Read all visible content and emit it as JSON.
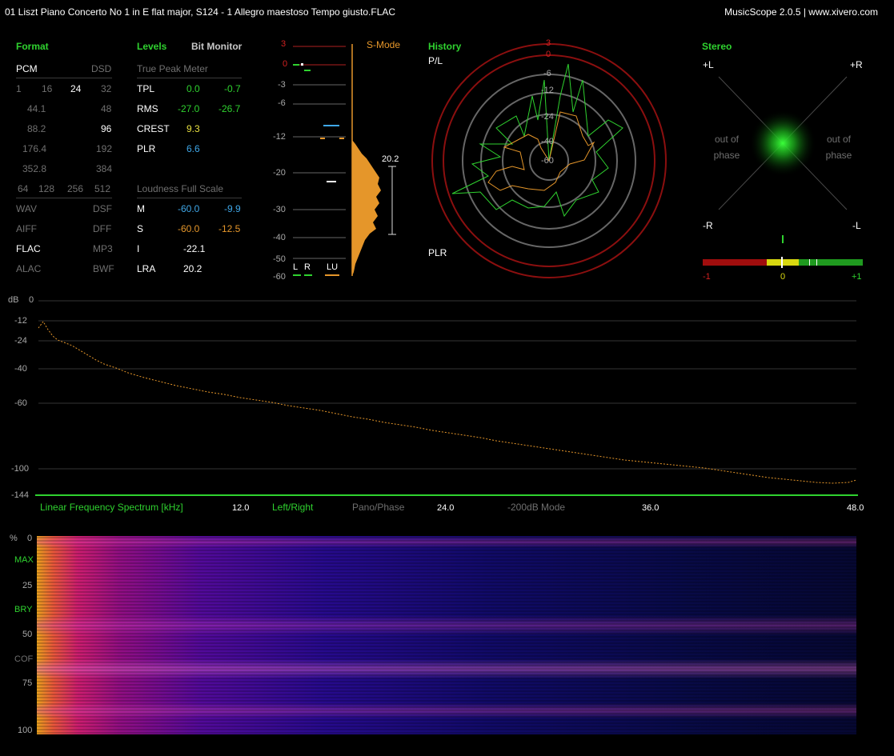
{
  "window": {
    "file_title": "01 Liszt Piano Concerto No 1 in E flat major, S124 - 1 Allegro maestoso Tempo giusto.FLAC",
    "app_title": "MusicScope 2.0.5 | www.xivero.com"
  },
  "format": {
    "header": "Format",
    "pcm": "PCM",
    "dsd": "DSD",
    "bits": [
      "1",
      "16",
      "24",
      "32"
    ],
    "rates": [
      [
        "44.1",
        "48"
      ],
      [
        "88.2",
        "96"
      ],
      [
        "176.4",
        "192"
      ],
      [
        "352.8",
        "384"
      ]
    ],
    "dsd_rates": [
      "64",
      "128",
      "256",
      "512"
    ],
    "types": [
      [
        "WAV",
        "DSF"
      ],
      [
        "AIFF",
        "DFF"
      ],
      [
        "FLAC",
        "MP3"
      ],
      [
        "ALAC",
        "BWF"
      ]
    ]
  },
  "levels": {
    "header": "Levels",
    "bit_monitor": "Bit Monitor",
    "true_peak_title": "True Peak Meter",
    "rows": [
      {
        "label": "TPL",
        "l": "0.0",
        "r": "-0.7"
      },
      {
        "label": "RMS",
        "l": "-27.0",
        "r": "-26.7"
      },
      {
        "label": "CREST",
        "v": "9.3"
      },
      {
        "label": "PLR",
        "v": "6.6"
      }
    ],
    "loudness_title": "Loudness Full Scale",
    "loud_rows": [
      {
        "label": "M",
        "l": "-60.0",
        "r": "-9.9"
      },
      {
        "label": "S",
        "l": "-60.0",
        "r": "-12.5"
      },
      {
        "label": "I",
        "v": "-22.1"
      },
      {
        "label": "LRA",
        "v": "20.2"
      }
    ]
  },
  "meter": {
    "mode": "S-Mode",
    "scale": [
      "3",
      "0",
      "-3",
      "-6",
      "-12",
      "-20",
      "-30",
      "-40",
      "-50",
      "-60"
    ],
    "bottom_labels": [
      "L",
      "R",
      "LU"
    ],
    "lra_value": "20.2"
  },
  "history": {
    "header": "History",
    "pl_label": "P/L",
    "plr_label": "PLR",
    "rings": [
      "3",
      "0",
      "-6",
      "-12",
      "-24",
      "-40",
      "-60"
    ]
  },
  "stereo": {
    "header": "Stereo",
    "plus_l": "+L",
    "plus_r": "+R",
    "minus_r": "-R",
    "minus_l": "-L",
    "out_of_phase": "out of phase",
    "corr_labels": [
      "-1",
      "0",
      "+1"
    ]
  },
  "spectrum": {
    "db_label": "dB",
    "db_ticks": [
      "0",
      "-12",
      "-24",
      "-40",
      "-60",
      "-100",
      "-144"
    ],
    "title": "Linear Frequency Spectrum [kHz]",
    "left_right": "Left/Right",
    "pano_phase": "Pano/Phase",
    "mode_200": "-200dB Mode",
    "freq_ticks": [
      "12.0",
      "24.0",
      "36.0",
      "48.0"
    ]
  },
  "spectrogram": {
    "pct": "%",
    "ticks": [
      "0",
      "25",
      "50",
      "75",
      "100"
    ],
    "markers": [
      "MAX",
      "BRY",
      "COF"
    ]
  },
  "colors": {
    "accent_green": "#2fd22f",
    "orange": "#e5962a",
    "red": "#d02020",
    "blue": "#3fa7e8"
  }
}
